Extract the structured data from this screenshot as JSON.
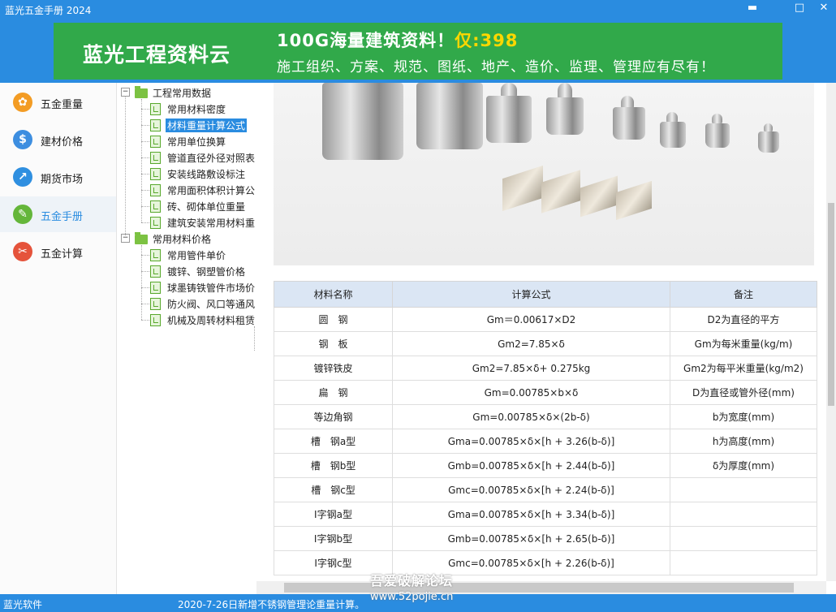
{
  "window": {
    "title": "蓝光五金手册 2024",
    "minimize": "▬",
    "maximize": "□",
    "close": "✕"
  },
  "banner": {
    "brand": "蓝光工程资料云",
    "headline": "100G海量建筑资料！",
    "price_prefix": "仅:",
    "price": "398",
    "tagline": "施工组织、方案、规范、图纸、地产、造价、监理、管理应有尽有！"
  },
  "nav": {
    "items": [
      {
        "label": "五金重量",
        "icon": "flower-icon",
        "color": "#f39c24",
        "glyph": "✿"
      },
      {
        "label": "建材价格",
        "icon": "dollar-icon",
        "color": "#3d8ee0",
        "glyph": "$"
      },
      {
        "label": "期货市场",
        "icon": "trend-chart-icon",
        "color": "#2f8fe0",
        "glyph": "↗"
      },
      {
        "label": "五金手册",
        "icon": "wrench-icon",
        "color": "#64b63a",
        "glyph": "✎"
      },
      {
        "label": "五金计算",
        "icon": "tools-icon",
        "color": "#e5533b",
        "glyph": "✂"
      }
    ],
    "active_index": 3
  },
  "tree": {
    "groups": [
      {
        "label": "工程常用数据",
        "expander": "−",
        "children": [
          "常用材料密度",
          "材料重量计算公式",
          "常用单位换算",
          "管道直径外径对照表",
          "安装线路敷设标注",
          "常用面积体积计算公",
          "砖、砌体单位重量",
          "建筑安装常用材料重"
        ]
      },
      {
        "label": "常用材料价格",
        "expander": "−",
        "children": [
          "常用管件单价",
          "镀锌、钢塑管价格",
          "球墨铸铁管件市场价",
          "防火阀、风口等通风",
          "机械及周转材料租赁"
        ]
      }
    ],
    "selected": "材料重量计算公式"
  },
  "table": {
    "headers": [
      "材料名称",
      "计算公式",
      "备注"
    ],
    "rows": [
      [
        "圆　钢",
        "Gm＝0.00617×D2",
        "D2为直径的平方"
      ],
      [
        "钢　板",
        "Gm2=7.85×δ",
        "Gm为每米重量(kg/m)"
      ],
      [
        "镀锌铁皮",
        "Gm2=7.85×δ+ 0.275kg",
        "Gm2为每平米重量(kg/m2)"
      ],
      [
        "扁　钢",
        "Gm=0.00785×b×δ",
        "D为直径或管外径(mm)"
      ],
      [
        "等边角钢",
        "Gm=0.00785×δ×(2b-δ)",
        "b为宽度(mm)"
      ],
      [
        "槽　钢a型",
        "Gma=0.00785×δ×[h + 3.26(b-δ)]",
        "h为高度(mm)"
      ],
      [
        "槽　钢b型",
        "Gmb=0.00785×δ×[h + 2.44(b-δ)]",
        "δ为厚度(mm)"
      ],
      [
        "槽　钢c型",
        "Gmc=0.00785×δ×[h + 2.24(b-δ)]",
        ""
      ],
      [
        "I字钢a型",
        "Gma=0.00785×δ×[h + 3.34(b-δ)]",
        ""
      ],
      [
        "I字钢b型",
        "Gmb=0.00785×δ×[h + 2.65(b-δ)]",
        ""
      ],
      [
        "I字钢c型",
        "Gmc=0.00785×δ×[h + 2.26(b-δ)]",
        ""
      ]
    ]
  },
  "status": {
    "left": "蓝光软件",
    "message": "2020-7-26日新增不锈钢管理论重量计算。"
  },
  "watermark": {
    "line1": "吾爱破解论坛",
    "line2": "www.52pojie.cn"
  },
  "colors": {
    "titlebar": "#2a8ce0",
    "banner": "#31a94a",
    "price": "#ffd700",
    "selection": "#2a8ce0",
    "table_header": "#dbe6f4"
  }
}
